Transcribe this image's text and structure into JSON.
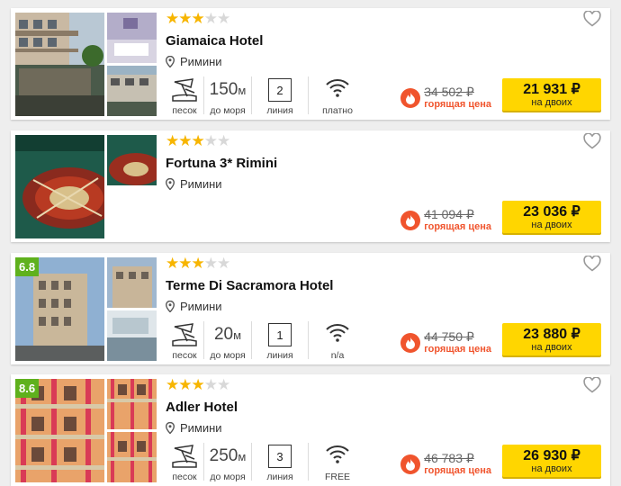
{
  "hotels": [
    {
      "stars": 3,
      "max_stars": 5,
      "name": "Giamaica Hotel",
      "city": "Римини",
      "rating": "",
      "features": {
        "beach": "песок",
        "distance_value": "150",
        "distance_unit": "м",
        "distance_label": "до моря",
        "line_value": "2",
        "line_label": "линия",
        "wifi_label": "платно"
      },
      "old_price": "34 502 ₽",
      "hot_label": "горящая цена",
      "price": "21 931 ₽",
      "price_note": "на двоих"
    },
    {
      "stars": 3,
      "max_stars": 5,
      "name": "Fortuna 3* Rimini",
      "city": "Римини",
      "rating": "",
      "old_price": "41 094 ₽",
      "hot_label": "горящая цена",
      "price": "23 036 ₽",
      "price_note": "на двоих"
    },
    {
      "stars": 3,
      "max_stars": 5,
      "name": "Terme Di Sacramora Hotel",
      "city": "Римини",
      "rating": "6.8",
      "features": {
        "beach": "песок",
        "distance_value": "20",
        "distance_unit": "м",
        "distance_label": "до моря",
        "line_value": "1",
        "line_label": "линия",
        "wifi_label": "n/a"
      },
      "old_price": "44 750 ₽",
      "hot_label": "горящая цена",
      "price": "23 880 ₽",
      "price_note": "на двоих"
    },
    {
      "stars": 3,
      "max_stars": 5,
      "name": "Adler Hotel",
      "city": "Римини",
      "rating": "8.6",
      "features": {
        "beach": "песок",
        "distance_value": "250",
        "distance_unit": "м",
        "distance_label": "до моря",
        "line_value": "3",
        "line_label": "линия",
        "wifi_label": "FREE"
      },
      "old_price": "46 783 ₽",
      "hot_label": "горящая цена",
      "price": "26 930 ₽",
      "price_note": "на двоих"
    }
  ],
  "icons": {
    "location": "map-pin-icon",
    "favorite": "heart-outline-icon",
    "beach": "beach-umbrella-icon",
    "wifi": "wifi-icon",
    "hot": "flame-icon"
  },
  "colors": {
    "star_on": "#f7b500",
    "star_off": "#d8d8d8",
    "hot": "#f0542d",
    "price_button": "#ffd600",
    "rating_badge": "#5fb11d"
  }
}
